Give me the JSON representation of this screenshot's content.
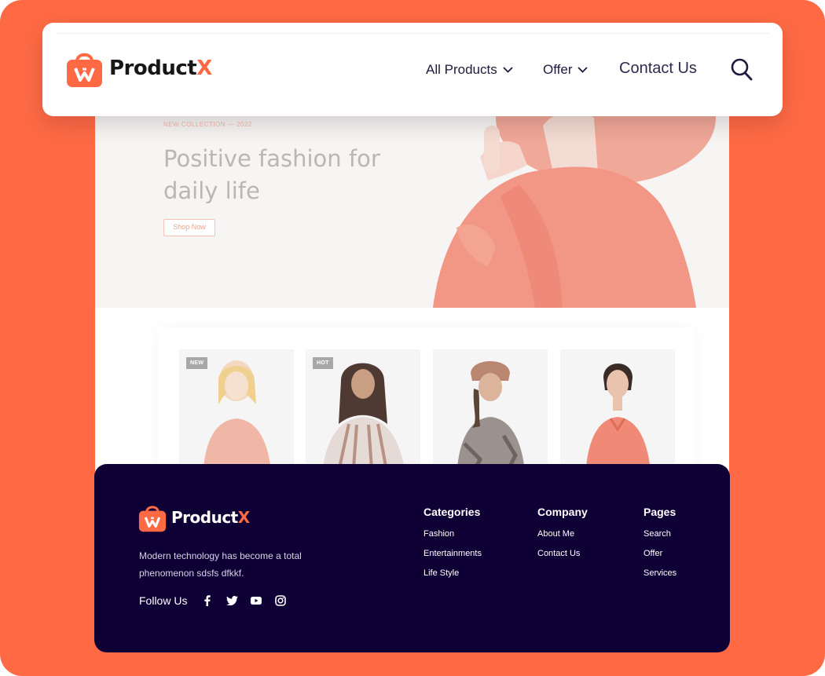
{
  "brand": {
    "name_main": "Product",
    "name_accent": "X",
    "accent_color": "#FF6A45",
    "footer_bg": "#0E0035"
  },
  "header": {
    "nav": [
      {
        "label": "All Products",
        "dropdown": true
      },
      {
        "label": "Offer",
        "dropdown": true
      }
    ],
    "contact_label": "Contact Us",
    "search_icon": "search-icon"
  },
  "hero": {
    "eyebrow": "NEW COLLECTION — 2022",
    "title": "Positive fashion for daily life",
    "button_label": "Shop Now"
  },
  "products": [
    {
      "badge": "NEW"
    },
    {
      "badge": "HOT"
    },
    {
      "badge": ""
    },
    {
      "badge": ""
    }
  ],
  "footer": {
    "description": "Modern technology has become a total phenomenon sdsfs dfkkf.",
    "follow_label": "Follow Us",
    "social_icons": [
      "facebook-icon",
      "twitter-icon",
      "youtube-icon",
      "instagram-icon"
    ],
    "columns": [
      {
        "title": "Categories",
        "links": [
          "Fashion",
          "Entertainments",
          "Life Style"
        ]
      },
      {
        "title": "Company",
        "links": [
          "About Me",
          "Contact Us"
        ]
      },
      {
        "title": "Pages",
        "links": [
          "Search",
          "Offer",
          "Services"
        ]
      }
    ]
  }
}
